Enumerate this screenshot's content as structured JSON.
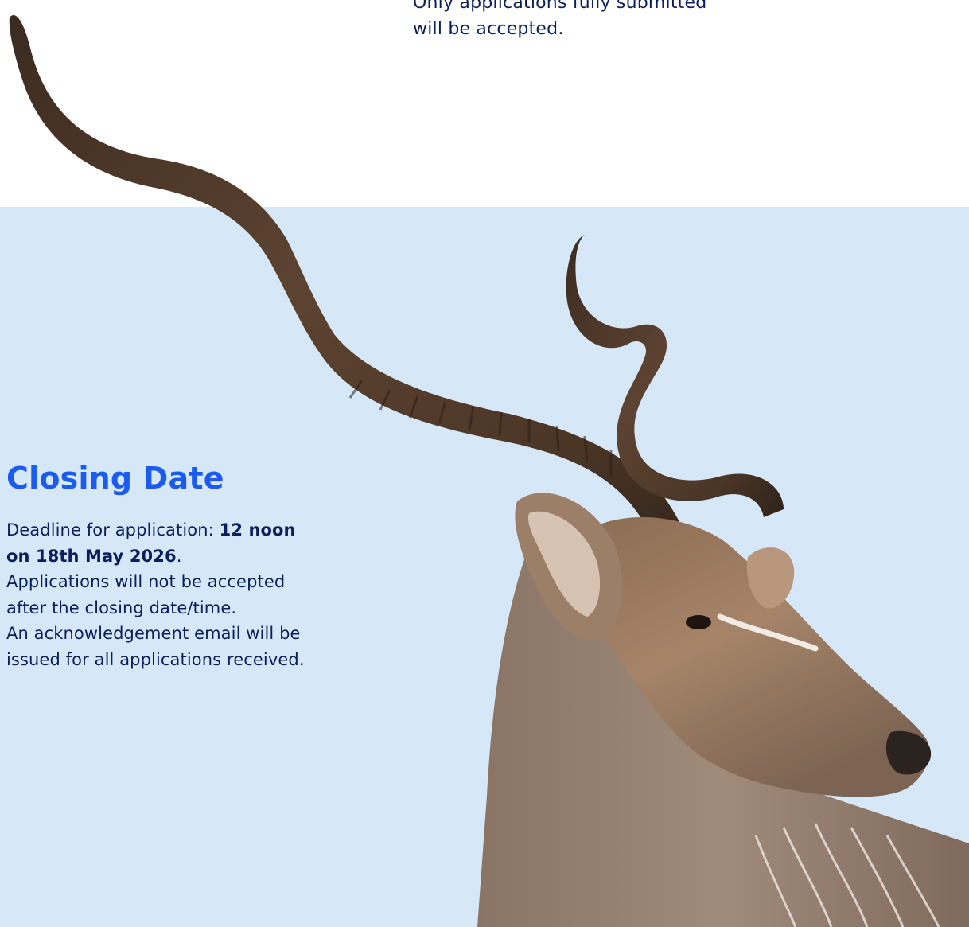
{
  "top_note": {
    "line1": "Only applications fully submitted",
    "line2": "will be accepted."
  },
  "closing": {
    "title": "Closing Date",
    "deadline_prefix": "Deadline for application: ",
    "deadline_bold_line1": "12 noon",
    "deadline_bold_line2": "on 18th May 2026",
    "deadline_suffix": ".",
    "not_accepted_line1": "Applications will not be accepted",
    "not_accepted_line2": "after the closing date/time.",
    "ack_line1": "An acknowledgement email will be",
    "ack_line2": "issued for all applications received."
  },
  "colors": {
    "panel_background": "#d6e8f8",
    "heading_accent": "#1b5cf0",
    "body_text": "#0b1f5c"
  },
  "image": {
    "subject": "kudu-antelope-photo"
  }
}
